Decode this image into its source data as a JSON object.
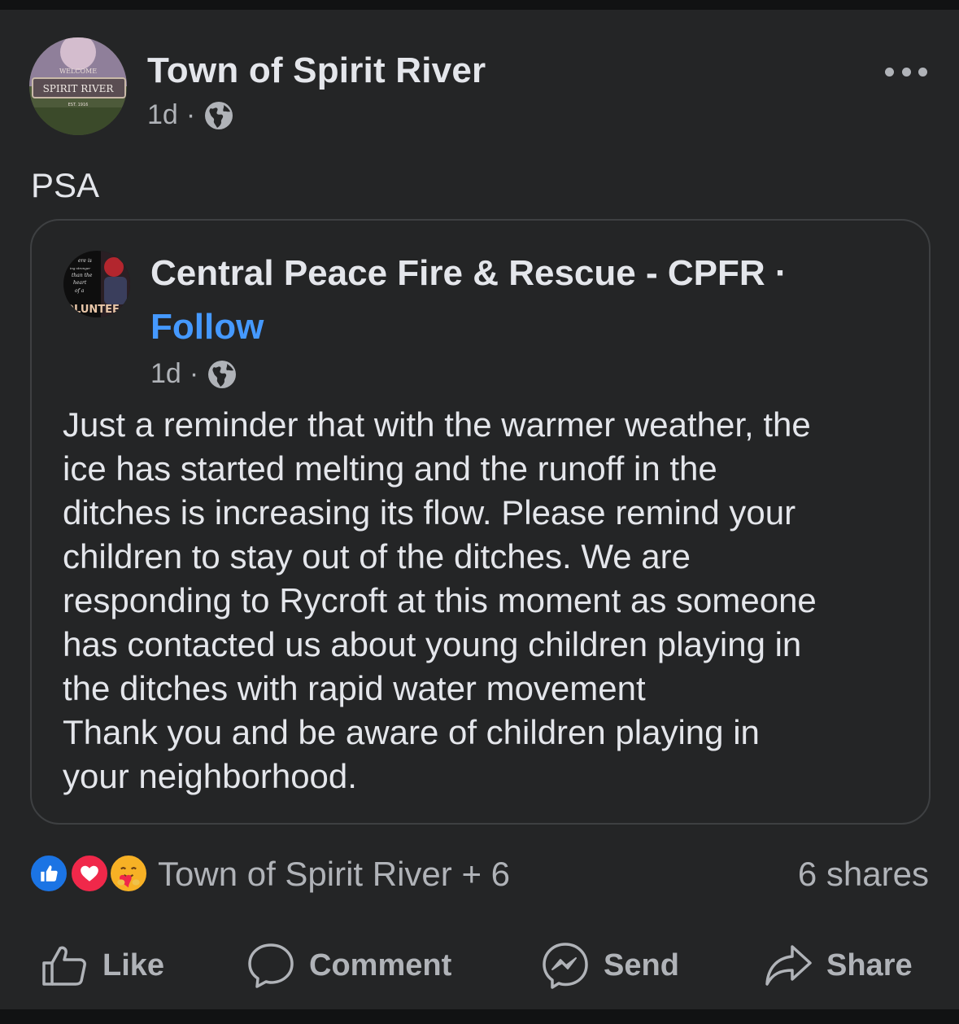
{
  "post": {
    "author": "Town of Spirit River",
    "time": "1d",
    "separator": "·",
    "text": "PSA",
    "avatar_sign": {
      "welcome": "WELCOME",
      "town": "SPIRIT RIVER",
      "est": "EST. 1916"
    }
  },
  "shared": {
    "author": "Central Peace Fire & Rescue - CPFR ·",
    "follow_label": "Follow",
    "time": "1d",
    "separator": "·",
    "avatar_text": {
      "l1": "ere is",
      "l2": "ing stronger",
      "l3": "than the",
      "l4": "heart",
      "l5": "of a",
      "l6": "OLUNTEE"
    },
    "body_lines": [
      "Just a reminder that with the warmer weather, the",
      "ice has started melting and the runoff in the",
      "ditches is increasing its flow.  Please remind your",
      "children to stay out of the ditches.  We are",
      "responding to Rycroft at this moment as someone",
      "has contacted us about young children playing in",
      "the ditches with rapid water movement",
      "Thank you and be aware of children playing in",
      "your neighborhood."
    ]
  },
  "reactions": {
    "icons": [
      "like-icon",
      "love-icon",
      "care-icon"
    ],
    "summary": "Town of Spirit River + 6",
    "shares": "6 shares"
  },
  "actions": {
    "like": "Like",
    "comment": "Comment",
    "send": "Send",
    "share": "Share"
  },
  "colors": {
    "background": "#242526",
    "text": "#e4e6eb",
    "secondary_text": "#b0b3b8",
    "link": "#4599ff",
    "like_blue": "#1b74e4",
    "love_red": "#f0284a",
    "care_yellow": "#f7b125"
  }
}
